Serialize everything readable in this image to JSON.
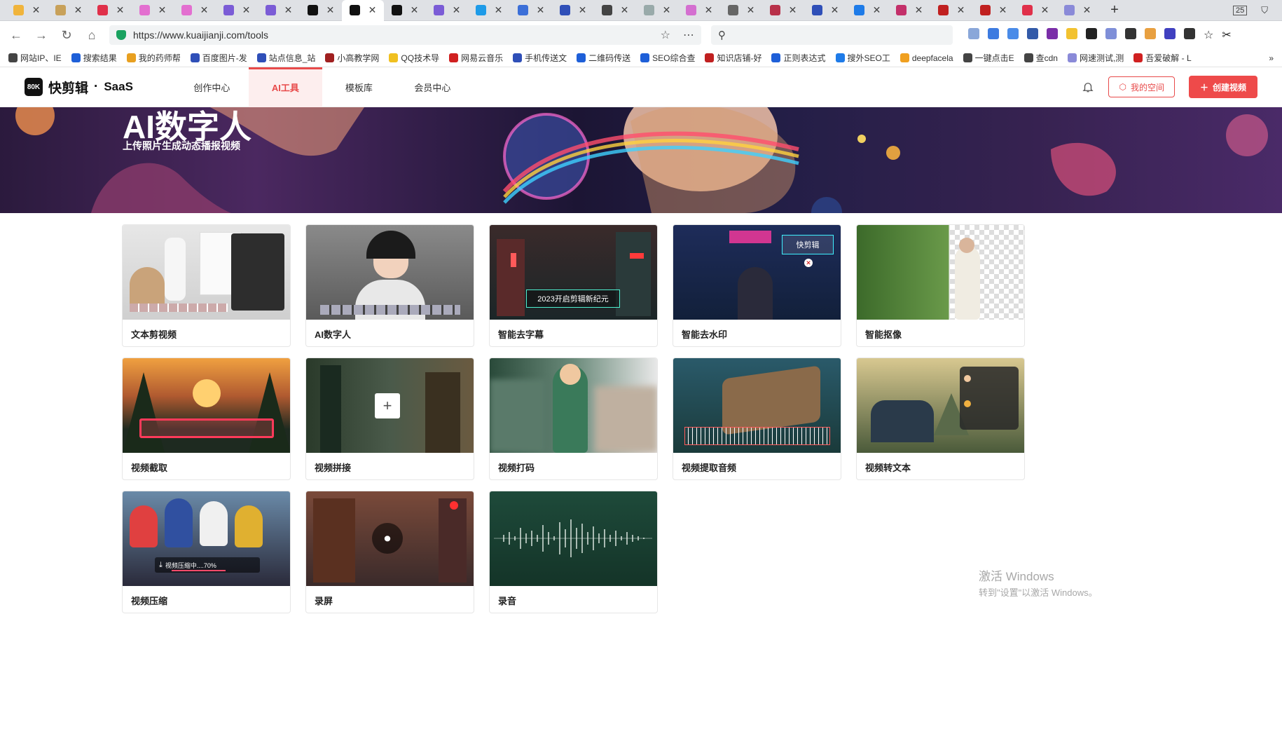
{
  "browser": {
    "tab_count_badge": "25",
    "url": "https://www.kuaijianji.com/tools",
    "bookmarks": [
      "网站IP、IE",
      "搜索结果",
      "我的药师帮",
      "百度图片-发",
      "站点信息_站",
      "小高教学网",
      "QQ技术导",
      "网易云音乐",
      "手机传送文",
      "二维码传送",
      "SEO综合查",
      "知识店铺-好",
      "正则表达式",
      "搜外SEO工",
      "deepfacela",
      "一键点击E",
      "查cdn",
      "网速测试,测",
      "吾爱破解 - L"
    ],
    "more_label": "»"
  },
  "header": {
    "logo_mark": "80K",
    "logo_text": "快剪辑",
    "logo_dot": "·",
    "logo_suffix": "SaaS",
    "nav": [
      {
        "label": "创作中心"
      },
      {
        "label": "AI工具"
      },
      {
        "label": "模板库"
      },
      {
        "label": "会员中心"
      }
    ],
    "my_space": "我的空间",
    "create_video": "创建视频"
  },
  "hero": {
    "title": "AI数字人",
    "subtitle": "上传照片生成动态播报视频"
  },
  "tools": [
    {
      "label": "文本剪视频"
    },
    {
      "label": "AI数字人"
    },
    {
      "label": "智能去字幕",
      "overlay": "2023开启剪辑新纪元"
    },
    {
      "label": "智能去水印",
      "overlay": "快剪辑"
    },
    {
      "label": "智能抠像"
    },
    {
      "label": "视频截取"
    },
    {
      "label": "视频拼接"
    },
    {
      "label": "视频打码"
    },
    {
      "label": "视频提取音频"
    },
    {
      "label": "视频转文本"
    },
    {
      "label": "视频压缩",
      "overlay": "视频压缩中....70%",
      "progress": 0.7
    },
    {
      "label": "录屏"
    },
    {
      "label": "录音"
    }
  ],
  "watermark": {
    "line1": "激活 Windows",
    "line2": "转到\"设置\"以激活 Windows。"
  }
}
